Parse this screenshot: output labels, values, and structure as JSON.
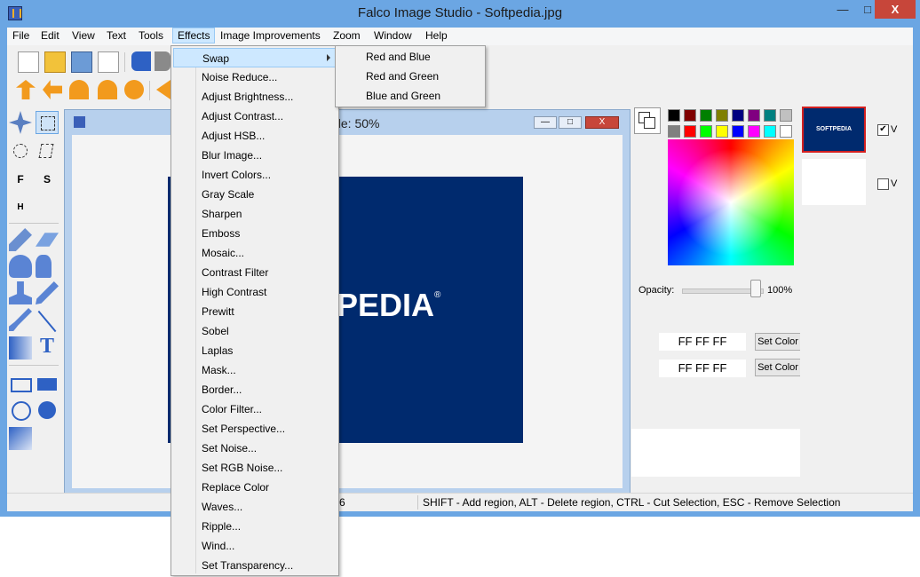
{
  "window": {
    "title": "Falco Image Studio - Softpedia.jpg",
    "close_glyph": "X",
    "min_glyph": "—",
    "max_glyph": "□"
  },
  "menubar": [
    "File",
    "Edit",
    "View",
    "Text",
    "Tools",
    "Effects",
    "Image Improvements",
    "Zoom",
    "Window",
    "Help"
  ],
  "document": {
    "title_text": "ale: 50%",
    "image_text": "PEDIA",
    "image_mark": "®"
  },
  "status": {
    "left_num": "6",
    "hint": "SHIFT - Add region, ALT - Delete region, CTRL - Cut Selection, ESC - Remove Selection"
  },
  "effects_menu": {
    "items": [
      "Swap",
      "Noise Reduce...",
      "Adjust Brightness...",
      "Adjust Contrast...",
      "Adjust HSB...",
      "Blur Image...",
      "Invert Colors...",
      "Gray Scale",
      "Sharpen",
      "Emboss",
      "Mosaic...",
      "Contrast Filter",
      "High Contrast",
      "Prewitt",
      "Sobel",
      "Laplas",
      "Mask...",
      "Border...",
      "Color Filter...",
      "Set Perspective...",
      "Set Noise...",
      "Set RGB Noise...",
      "Replace Color",
      "Waves...",
      "Ripple...",
      "Wind...",
      "Set Transparency..."
    ],
    "highlighted": "Swap"
  },
  "swap_submenu": [
    "Red and Blue",
    "Red and Green",
    "Blue and Green"
  ],
  "color_panel": {
    "palette_row1": [
      "#000000",
      "#800000",
      "#008000",
      "#808000",
      "#000080",
      "#800080",
      "#008080",
      "#c0c0c0"
    ],
    "palette_row2": [
      "#808080",
      "#ff0000",
      "#00ff00",
      "#ffff00",
      "#0000ff",
      "#ff00ff",
      "#00ffff",
      "#ffffff"
    ],
    "opacity_label": "Opacity:",
    "opacity_value": "100%",
    "opacity_level": 1.0,
    "hex1": "FF FF FF",
    "hex2": "FF FF FF",
    "set_color_label": "Set Color"
  },
  "layers": {
    "layer1_thumb_text": "SOFTPEDIA",
    "layer1_checked": "✔",
    "layer_label": "V"
  },
  "colors": {
    "titlebar": "#6ba6e3",
    "image_bg": "#002a6e",
    "highlight": "#cde8ff"
  }
}
